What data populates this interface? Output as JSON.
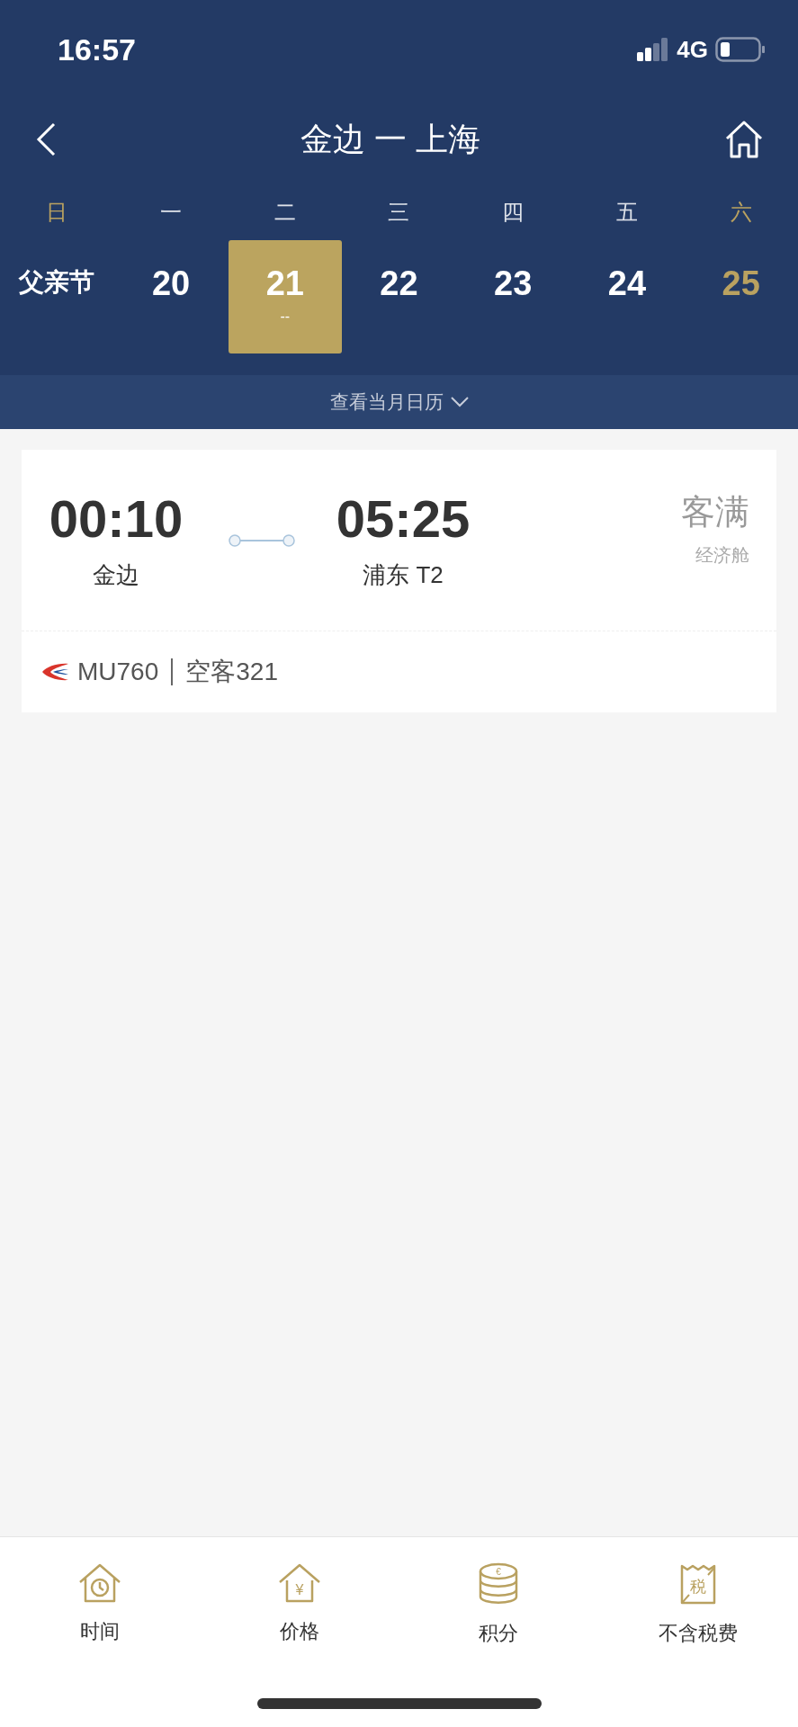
{
  "status_bar": {
    "time": "16:57",
    "network": "4G"
  },
  "nav": {
    "title": "金边 一 上海"
  },
  "calendar": {
    "days": [
      {
        "weekday": "日",
        "date": "父亲节",
        "kind": "holiday",
        "weekend": true,
        "selected": false
      },
      {
        "weekday": "一",
        "date": "20",
        "kind": "day",
        "weekend": false,
        "selected": false
      },
      {
        "weekday": "二",
        "date": "21",
        "kind": "day",
        "weekend": false,
        "selected": true,
        "price": "--"
      },
      {
        "weekday": "三",
        "date": "22",
        "kind": "day",
        "weekend": false,
        "selected": false
      },
      {
        "weekday": "四",
        "date": "23",
        "kind": "day",
        "weekend": false,
        "selected": false
      },
      {
        "weekday": "五",
        "date": "24",
        "kind": "day",
        "weekend": false,
        "selected": false
      },
      {
        "weekday": "六",
        "date": "25",
        "kind": "day",
        "weekend": true,
        "selected": false
      }
    ],
    "month_link": "查看当月日历"
  },
  "flights": [
    {
      "depart_time": "00:10",
      "depart_airport": "金边",
      "arrive_time": "05:25",
      "arrive_airport": "浦东 T2",
      "status": "客满",
      "cabin": "经济舱",
      "flight_no": "MU760",
      "aircraft": "空客321"
    }
  ],
  "bottom_bar": [
    {
      "label": "时间",
      "kind": "clock"
    },
    {
      "label": "价格",
      "kind": "price",
      "glyph": "¥"
    },
    {
      "label": "积分",
      "kind": "coins",
      "glyph": "€"
    },
    {
      "label": "不含税费",
      "kind": "tax",
      "glyph": "税"
    }
  ]
}
